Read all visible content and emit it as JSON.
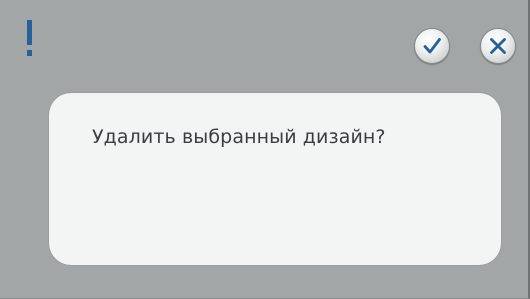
{
  "dialog": {
    "icons": {
      "alert": "exclamation-icon",
      "confirm": "checkmark-icon",
      "cancel": "close-icon"
    },
    "message": "Удалить выбранный дизайн?"
  },
  "colors": {
    "background": "#a3a6a6",
    "panel": "#f3f5f5",
    "accent": "#27619a",
    "text": "#3a3e40"
  }
}
